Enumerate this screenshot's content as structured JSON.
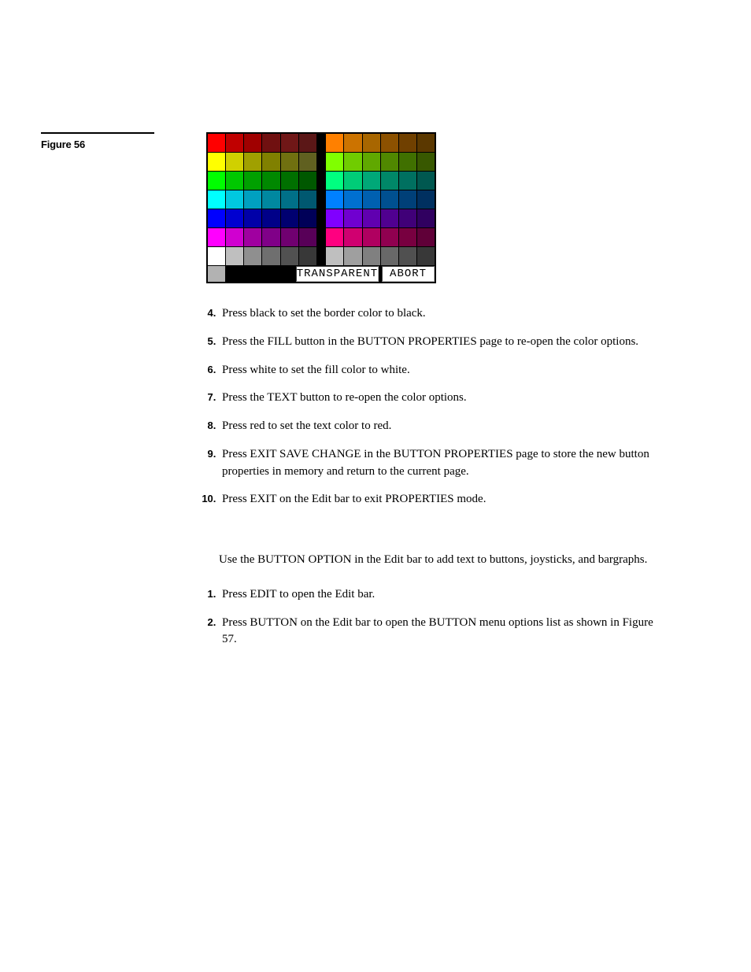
{
  "figure": {
    "label": "Figure 56",
    "buttons": {
      "transparent": "TRANSPARENT",
      "abort": "ABORT"
    },
    "palette": [
      [
        [
          "#ff0000",
          "#c00000",
          "#a00000",
          "#701010",
          "#701717",
          "#5b1717"
        ],
        [
          "#ff8000",
          "#cc7300",
          "#a86600",
          "#8c5100",
          "#704000",
          "#5b3800"
        ]
      ],
      [
        [
          "#ffff00",
          "#d0d000",
          "#a0a000",
          "#808000",
          "#707010",
          "#606020"
        ],
        [
          "#80ff00",
          "#70cc00",
          "#60a800",
          "#508800",
          "#407000",
          "#385800"
        ]
      ],
      [
        [
          "#00ff00",
          "#00c800",
          "#00a000",
          "#008800",
          "#007000",
          "#005800"
        ],
        [
          "#00ff80",
          "#00cc78",
          "#00a878",
          "#008868",
          "#007060",
          "#005850"
        ]
      ],
      [
        [
          "#00ffff",
          "#00c8e0",
          "#00a0c0",
          "#0088a0",
          "#007088",
          "#005870"
        ],
        [
          "#0080ff",
          "#0070d0",
          "#0060b0",
          "#005090",
          "#004078",
          "#003060"
        ]
      ],
      [
        [
          "#0000ff",
          "#0000d0",
          "#0000a8",
          "#000088",
          "#000070",
          "#000058"
        ],
        [
          "#8000ff",
          "#7000d0",
          "#6000b0",
          "#500090",
          "#400078",
          "#300060"
        ]
      ],
      [
        [
          "#ff00ff",
          "#d000d0",
          "#a000a0",
          "#800088",
          "#700070",
          "#580058"
        ],
        [
          "#ff0080",
          "#d00070",
          "#b00060",
          "#900050",
          "#780040",
          "#600038"
        ]
      ],
      [
        [
          "#ffffff",
          "#bfbfbf",
          "#8f8f8f",
          "#6f6f6f",
          "#515151",
          "#383838"
        ],
        [
          "#bfbfbf",
          "#9f9f9f",
          "#808080",
          "#686868",
          "#505050",
          "#383838"
        ]
      ]
    ]
  },
  "steps1": [
    {
      "n": 4,
      "t": "Press black to set the border color to black."
    },
    {
      "n": 5,
      "t": "Press the FILL button in the BUTTON PROPERTIES page to re-open the color options."
    },
    {
      "n": 6,
      "t": "Press white to set the fill color to white."
    },
    {
      "n": 7,
      "t": "Press the TEXT button to re-open the color options."
    },
    {
      "n": 8,
      "t": "Press red to set the text color to red."
    },
    {
      "n": 9,
      "t": "Press EXIT SAVE CHANGE in the BUTTON PROPERTIES page to store the new button properties in memory and return to the current page."
    },
    {
      "n": 10,
      "t": "Press EXIT on the Edit bar to exit PROPERTIES mode."
    }
  ],
  "para": "Use the BUTTON OPTION in the Edit bar to add text to buttons, joysticks, and bargraphs.",
  "steps2": [
    {
      "n": 1,
      "t": "Press EDIT to open the Edit bar."
    },
    {
      "n": 2,
      "t": "Press BUTTON on the Edit bar to open the BUTTON menu options list as shown in Figure 57."
    }
  ]
}
